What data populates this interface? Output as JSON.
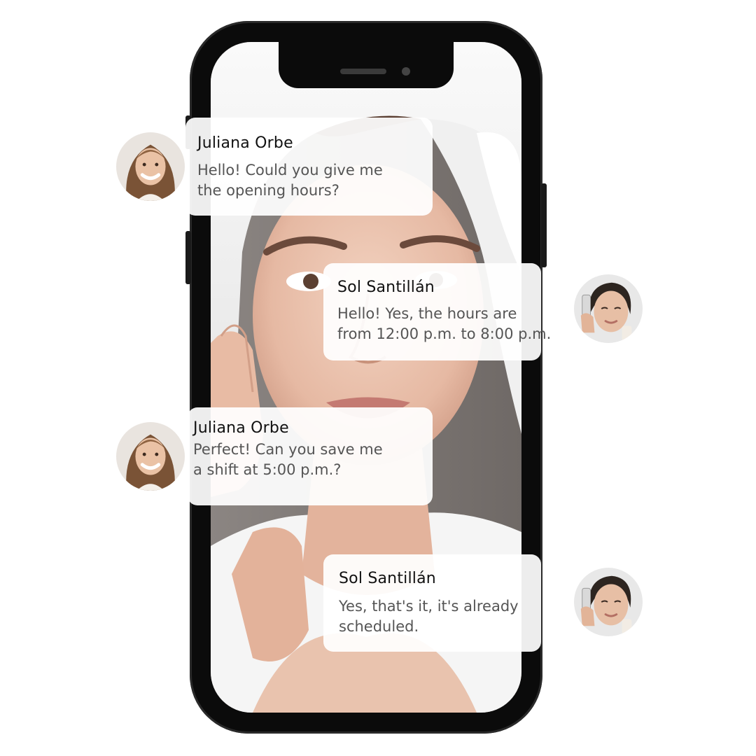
{
  "conversation": {
    "messages": [
      {
        "sender": "Juliana Orbe",
        "lines": [
          "Hello! Could you give me",
          "the opening hours?"
        ],
        "avatar": "juliana-orbe-avatar"
      },
      {
        "sender": "Sol Santillán",
        "lines": [
          "Hello! Yes, the hours are",
          "from 12:00 p.m. to 8:00 p.m."
        ],
        "avatar": "sol-santillan-avatar"
      },
      {
        "sender": "Juliana Orbe",
        "lines": [
          "Perfect! Can you save me",
          "a shift at 5:00 p.m.?"
        ],
        "avatar": "juliana-orbe-avatar"
      },
      {
        "sender": "Sol Santillán",
        "lines": [
          "Yes, that's it, it's already",
          "scheduled."
        ],
        "avatar": "sol-santillan-avatar"
      }
    ]
  },
  "colors": {
    "phone_frame": "#0b0b0b",
    "bubble_background": "#ffffff",
    "sender_name": "#111111",
    "message_text": "#555555",
    "screen_background": "#77716d"
  }
}
